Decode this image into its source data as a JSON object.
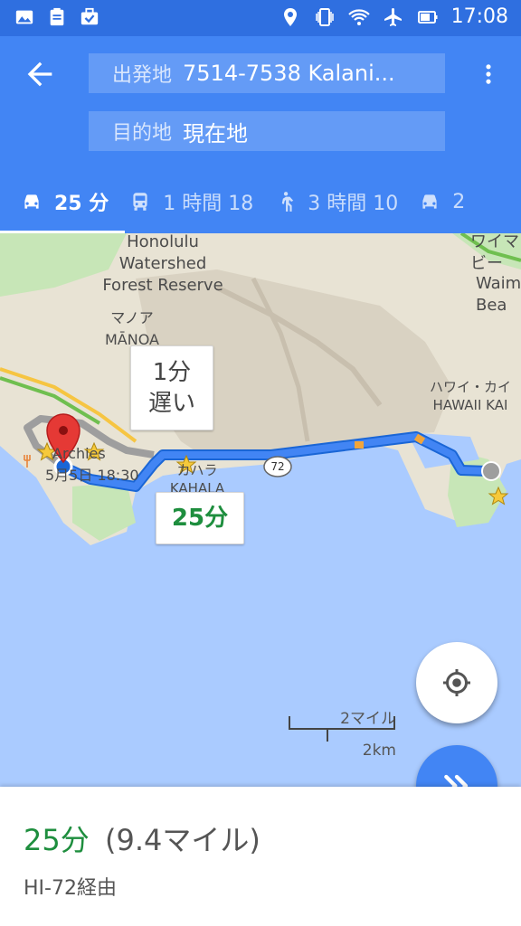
{
  "status_bar": {
    "time": "17:08"
  },
  "header": {
    "origin_label": "出発地",
    "origin_value": "7514-7538 Kalani...",
    "destination_label": "目的地",
    "destination_value": "現在地",
    "modes": [
      {
        "icon": "car-icon",
        "label": "25 分",
        "active": true
      },
      {
        "icon": "transit-icon",
        "label": "1 時間 18",
        "active": false
      },
      {
        "icon": "walk-icon",
        "label": "3 時間 10",
        "active": false
      },
      {
        "icon": "taxi-icon",
        "label": "2",
        "active": false
      }
    ]
  },
  "map": {
    "labels": {
      "honolulu_watershed": "Honolulu\nWatershed\nForest Reserve",
      "manoa": "マノア\nMĀNOA",
      "kahala": "カハラ\nKAHALA",
      "hawaii_kai": "ハワイ・カイ\nHAWAII KAI",
      "waimea": "ワイマ\nビー",
      "waimea2": "Waim\nBea",
      "archies": "Archies",
      "event": "5月5日 18:30",
      "route_shield": "72"
    },
    "callouts": {
      "delay": "1分\n遅い",
      "primary": "25分"
    },
    "scale": {
      "miles": "2マイル",
      "km": "2km"
    },
    "route_color": "#4285f4",
    "alt_route_color": "#9e9e9e"
  },
  "bottom_sheet": {
    "duration": "25分",
    "distance": "(9.4マイル)",
    "via": "HI-72経由"
  },
  "colors": {
    "header": "#4285f4",
    "status_bar": "#2f6fe0",
    "duration_green": "#1e8e3e"
  }
}
